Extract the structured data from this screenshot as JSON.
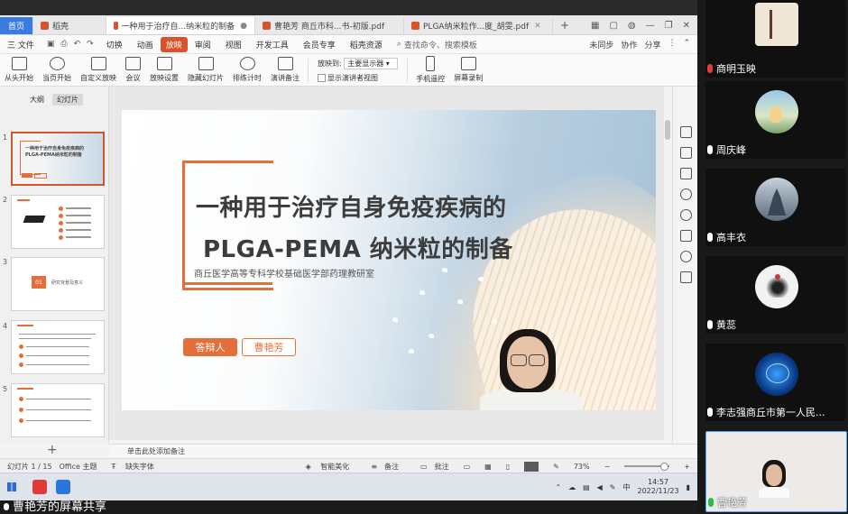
{
  "tabs": [
    {
      "label": "首页",
      "type": "home"
    },
    {
      "label": "稻壳",
      "color": "#d7532c"
    },
    {
      "label": "一种用于治疗自...纳米粒的制备",
      "color": "#d7532c",
      "active": true
    },
    {
      "label": "曹艳芳 商丘市科...书-初版.pdf",
      "color": "#d7532c"
    },
    {
      "label": "PLGA纳米粒作...度_胡雯.pdf",
      "color": "#d7532c"
    }
  ],
  "menubar": {
    "file": "三 文件",
    "items": [
      "切换",
      "动画",
      "放映",
      "审阅",
      "视图",
      "开发工具",
      "会员专享",
      "稻壳资源"
    ],
    "active_index": 2,
    "search": "查找命令、搜索模板",
    "right": [
      "未同步",
      "协作",
      "分享"
    ]
  },
  "ribbon": {
    "buttons": [
      "从头开始",
      "当页开始",
      "自定义放映",
      "会议",
      "放映设置",
      "隐藏幻灯片",
      "排练计时",
      "演讲备注"
    ],
    "display_label": "放映到:",
    "display_value": "主要显示器",
    "presenter_view": "显示演讲者视图",
    "right_buttons": [
      "手机遥控",
      "屏幕录制"
    ]
  },
  "leftpane": {
    "tabs": [
      "大纲",
      "幻灯片"
    ],
    "active_tab": 1,
    "slide_numbers": [
      "1",
      "2",
      "3",
      "4",
      "5"
    ],
    "thumb1_title": "一种用于治疗自身免疫疾病的PLGA-PEMA纳米粒的制备",
    "thumb3_num": "01",
    "thumb3_text": "研究背景及意义"
  },
  "slide": {
    "title_line1": "一种用于治疗自身免疫疾病的",
    "title_line2": "PLGA-PEMA 纳米粒的制备",
    "subtitle": "商丘医学高等专科学校基础医学部药理教研室",
    "btn_defender": "答辩人",
    "btn_name": "曹艳芳"
  },
  "notes": {
    "placeholder": "单击此处添加备注"
  },
  "statusbar": {
    "slide_info": "幻灯片 1 / 15",
    "theme": "Office 主题",
    "font_missing": "缺失字体",
    "beautify": "智能美化",
    "notes_btn": "备注",
    "comment_btn": "批注",
    "zoom": "73%"
  },
  "taskbar": {
    "lang": "中",
    "time": "14:57",
    "date": "2022/11/23"
  },
  "participants": [
    {
      "name": "商明玉映",
      "muted": true
    },
    {
      "name": "周庆峰",
      "muted": false
    },
    {
      "name": "高丰衣",
      "muted": false
    },
    {
      "name": "黄蕊",
      "muted": false
    },
    {
      "name": "李志强商丘市第一人民...",
      "muted": false
    },
    {
      "name": "曹艳芳",
      "muted": false,
      "active": true
    }
  ],
  "bottom_caption": "曹艳芳的屏幕共享"
}
